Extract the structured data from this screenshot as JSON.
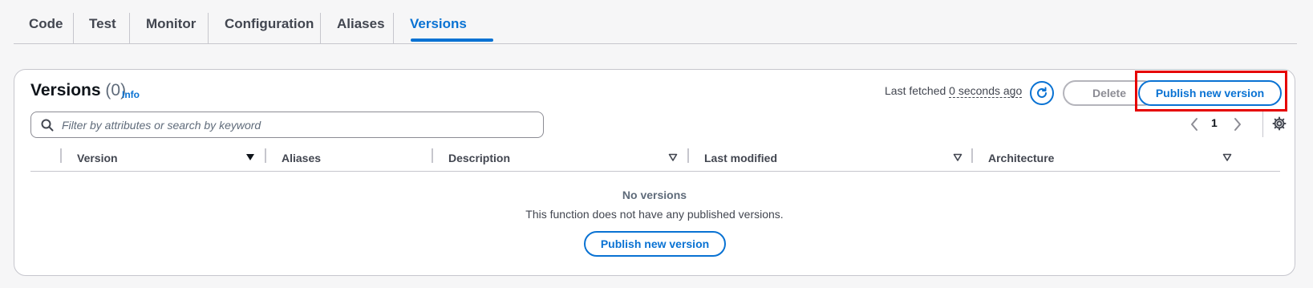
{
  "tabs": [
    {
      "label": "Code"
    },
    {
      "label": "Test"
    },
    {
      "label": "Monitor"
    },
    {
      "label": "Configuration"
    },
    {
      "label": "Aliases"
    },
    {
      "label": "Versions",
      "active": true
    }
  ],
  "header": {
    "title": "Versions",
    "count": "(0)",
    "info": "Info",
    "last_fetched_prefix": "Last fetched",
    "last_fetched_ago": "0 seconds ago",
    "delete_label": "Delete",
    "publish_label": "Publish new version"
  },
  "search": {
    "placeholder": "Filter by attributes or search by keyword"
  },
  "pagination": {
    "current_page": "1"
  },
  "table": {
    "columns": [
      "Version",
      "Aliases",
      "Description",
      "Last modified",
      "Architecture"
    ]
  },
  "empty_state": {
    "title": "No versions",
    "description": "This function does not have any published versions.",
    "button_label": "Publish new version"
  },
  "colors": {
    "accent": "#0972d3",
    "highlight": "#e60000",
    "border": "#c6c6cd"
  }
}
